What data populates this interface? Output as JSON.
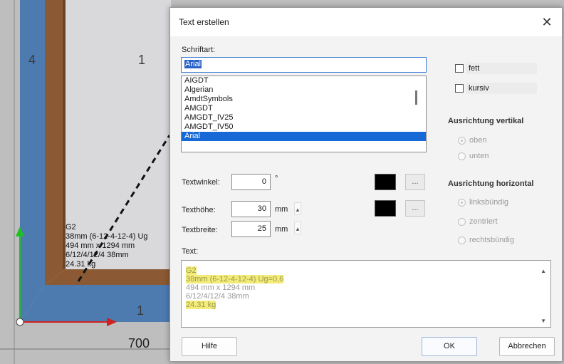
{
  "cad": {
    "label_4": "4",
    "label_1_top": "1",
    "label_1_bottom": "1",
    "dimension": "700",
    "note_lines": [
      "G2",
      "38mm (6-12-4-12-4)  Ug",
      "494 mm x 1294 mm",
      "6/12/4/12/4  38mm",
      "24.31 kg"
    ]
  },
  "dialog": {
    "title": "Text erstellen",
    "close_glyph": "✕",
    "font_label": "Schriftart:",
    "font_value": "Arial",
    "font_options": [
      "AIGDT",
      "Algerian",
      "AmdtSymbols",
      "AMGDT",
      "AMGDT_IV25",
      "AMGDT_IV50",
      "Arial"
    ],
    "selected_font_index": 6,
    "bold_label": "fett",
    "italic_label": "kursiv",
    "bold_checked": false,
    "italic_checked": false,
    "valign_title": "Ausrichtung vertikal",
    "valign_options": [
      "oben",
      "unten"
    ],
    "halign_title": "Ausrichtung horizontal",
    "halign_options": [
      "linksbündig",
      "zentriert",
      "rechtsbündig"
    ],
    "angle_label": "Textwinkel:",
    "angle_value": "0",
    "angle_unit": "°",
    "height_label": "Texthöhe:",
    "height_value": "30",
    "height_unit": "mm",
    "width_label": "Textbreite:",
    "width_value": "25",
    "width_unit": "mm",
    "ellipsis": "...",
    "text_label": "Text:",
    "text_lines": [
      "G2",
      "38mm (6-12-4-12-4)  Ug=0,6",
      "494 mm x 1294 mm",
      "6/12/4/12/4  38mm",
      "24.31 kg"
    ],
    "help_button": "Hilfe",
    "ok_button": "OK",
    "cancel_button": "Abbrechen"
  },
  "colors": {
    "text_color_1": "#000000",
    "text_color_2": "#000000",
    "highlight": "#f4ec7a",
    "selection_blue": "#1769d6"
  }
}
